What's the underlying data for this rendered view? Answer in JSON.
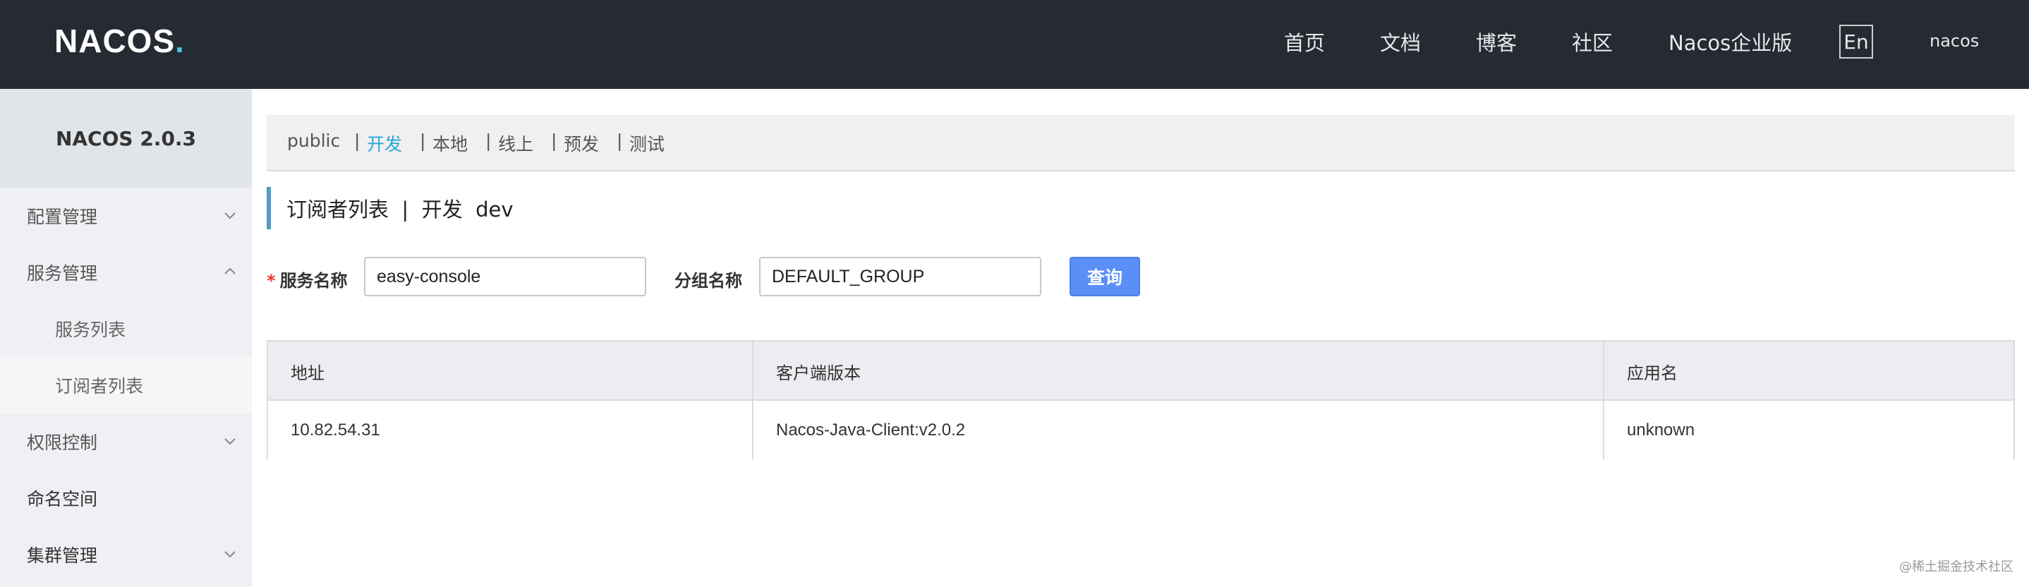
{
  "header": {
    "logo_text": "NACOS",
    "logo_dot": ".",
    "nav": [
      "首页",
      "文档",
      "博客",
      "社区",
      "Nacos企业版"
    ],
    "lang": "En",
    "user": "nacos"
  },
  "sidebar": {
    "version": "NACOS 2.0.3",
    "items": [
      {
        "label": "配置管理",
        "expanded": false
      },
      {
        "label": "服务管理",
        "expanded": true
      },
      {
        "label": "服务列表"
      },
      {
        "label": "订阅者列表",
        "active": true
      },
      {
        "label": "权限控制",
        "expanded": false
      },
      {
        "label": "命名空间"
      },
      {
        "label": "集群管理",
        "expanded": false
      }
    ]
  },
  "namespaces": {
    "items": [
      "public",
      "开发",
      "本地",
      "线上",
      "预发",
      "测试"
    ],
    "active": "开发",
    "separator": "|"
  },
  "page": {
    "title": "订阅者列表  |  开发  dev"
  },
  "form": {
    "required_mark": "*",
    "service_label": "服务名称",
    "service_value": "easy-console",
    "group_label": "分组名称",
    "group_value": "DEFAULT_GROUP",
    "query_label": "查询"
  },
  "table": {
    "headers": [
      "地址",
      "客户端版本",
      "应用名"
    ],
    "rows": [
      [
        "10.82.54.31",
        "Nacos-Java-Client:v2.0.2",
        "unknown"
      ]
    ]
  },
  "watermark": "@稀土掘金技术社区",
  "colors": {
    "header_bg": "#252a33",
    "accent": "#26a8d9",
    "button": "#5b8ef7",
    "title_bar": "#4f9ac9"
  }
}
